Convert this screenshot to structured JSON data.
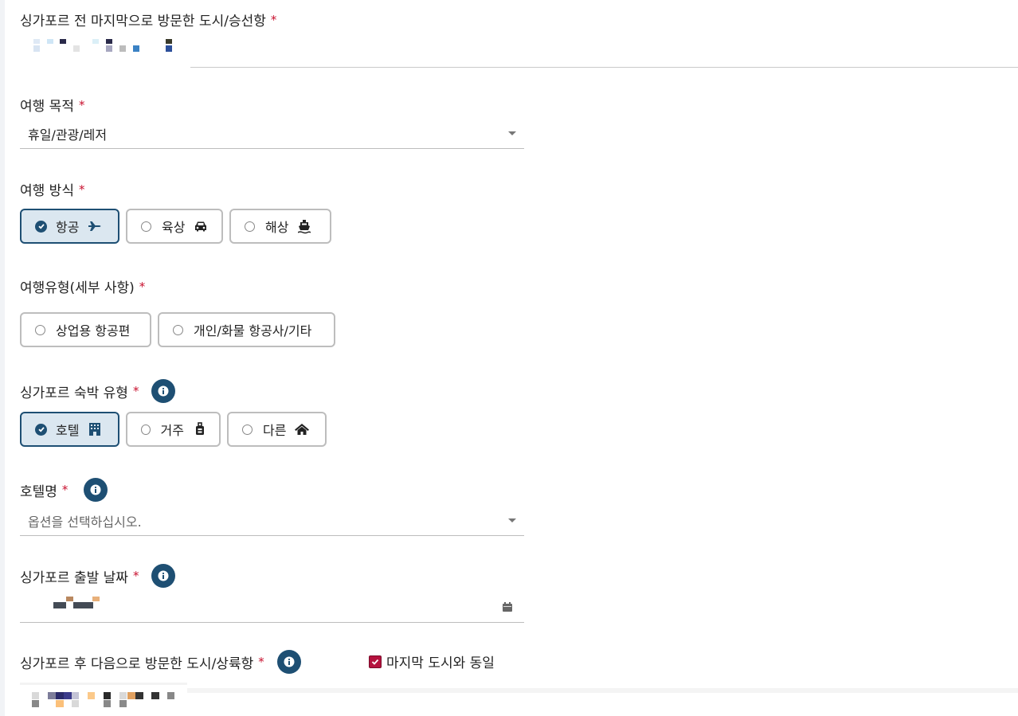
{
  "fields": {
    "last_city": {
      "label": "싱가포르 전 마지막으로 방문한 도시/승선항",
      "required": "*"
    },
    "trip_purpose": {
      "label": "여행 목적",
      "required": "*",
      "value": "휴일/관광/레저"
    },
    "travel_mode": {
      "label": "여행 방식",
      "required": "*",
      "options": [
        {
          "label": "항공",
          "icon": "plane-icon",
          "selected": true
        },
        {
          "label": "육상",
          "icon": "car-icon",
          "selected": false
        },
        {
          "label": "해상",
          "icon": "ship-icon",
          "selected": false
        }
      ]
    },
    "travel_type": {
      "label": "여행유형(세부 사항)",
      "required": "*",
      "options": [
        {
          "label": "상업용 항공편",
          "selected": false
        },
        {
          "label": "개인/화물 항공사/기타",
          "selected": false
        }
      ]
    },
    "accommodation_type": {
      "label": "싱가포르 숙박 유형",
      "required": "*",
      "options": [
        {
          "label": "호텔",
          "icon": "hotel-building-icon",
          "selected": true
        },
        {
          "label": "거주",
          "icon": "luggage-icon",
          "selected": false
        },
        {
          "label": "다른",
          "icon": "home-icon",
          "selected": false
        }
      ]
    },
    "hotel_name": {
      "label": "호텔명",
      "required": "*",
      "placeholder": "옵션을 선택하십시오."
    },
    "departure_date": {
      "label": "싱가포르 출발 날짜",
      "required": "*"
    },
    "next_city": {
      "label": "싱가포르 후 다음으로 방문한 도시/상륙항",
      "required": "*",
      "same_as_last_label": "마지막 도시와 동일",
      "same_as_last_checked": true
    }
  },
  "colors": {
    "accent": "#1e4f73",
    "required": "#c8102e",
    "checkbox": "#b5123e",
    "active_bg": "#dbe7f0"
  }
}
